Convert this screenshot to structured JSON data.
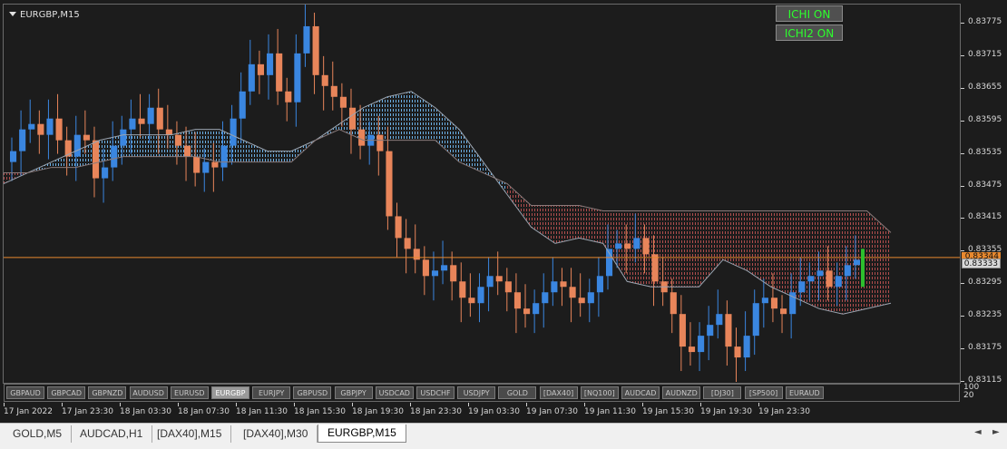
{
  "symbol_label": "EURGBP,M15",
  "buttons": {
    "ichi": "ICHI ON",
    "ichi2": "ICHI2 ON"
  },
  "colors": {
    "bull": "#3a86e0",
    "bear": "#e8855a",
    "cloud_bull": "#6fb7ef",
    "cloud_bear": "#a04848",
    "price_line": "#e8892f",
    "signal": "#2dbf2d",
    "background": "#1c1c1c"
  },
  "price_axis": {
    "ticks": [
      "0.83775",
      "0.83715",
      "0.83655",
      "0.83595",
      "0.83535",
      "0.83475",
      "0.83415",
      "0.83355",
      "0.83295",
      "0.83235",
      "0.83175",
      "0.83115"
    ],
    "bid_tag": "0.83344",
    "ask_tag": "0.83333"
  },
  "time_axis": {
    "ticks": [
      "17 Jan 2022",
      "17 Jan 23:30",
      "18 Jan 03:30",
      "18 Jan 07:30",
      "18 Jan 11:30",
      "18 Jan 15:30",
      "18 Jan 19:30",
      "18 Jan 23:30",
      "19 Jan 03:30",
      "19 Jan 07:30",
      "19 Jan 11:30",
      "19 Jan 15:30",
      "19 Jan 19:30",
      "19 Jan 23:30"
    ]
  },
  "indicator_scale": [
    "100",
    "20"
  ],
  "symbols": [
    "GBPAUD",
    "GBPCAD",
    "GBPNZD",
    "AUDUSD",
    "EURUSD",
    "EURGBP",
    "EURJPY",
    "GBPUSD",
    "GBPJPY",
    "USDCAD",
    "USDCHF",
    "USDJPY",
    "GOLD",
    "[DAX40]",
    "[NQ100]",
    "AUDCAD",
    "AUDNZD",
    "[DJ30]",
    "[SP500]",
    "EURAUD"
  ],
  "active_symbol": "EURGBP",
  "tabs": [
    "GOLD,M5",
    "AUDCAD,H1",
    "[DAX40],M15",
    "[DAX40],M30",
    "EURGBP,M15"
  ],
  "active_tab": "EURGBP,M15",
  "chart_data": {
    "type": "candlestick",
    "symbol": "EURGBP",
    "timeframe": "M15",
    "ylim": [
      0.8311,
      0.8381
    ],
    "series": [
      {
        "name": "close",
        "values": [
          0.8354,
          0.8358,
          0.8359,
          0.8357,
          0.836,
          0.8356,
          0.8353,
          0.8357,
          0.8356,
          0.8349,
          0.8351,
          0.8355,
          0.8358,
          0.836,
          0.8359,
          0.8362,
          0.8358,
          0.8357,
          0.8355,
          0.8353,
          0.835,
          0.8352,
          0.8351,
          0.8355,
          0.836,
          0.8365,
          0.837,
          0.8368,
          0.8372,
          0.8365,
          0.8363,
          0.8372,
          0.8377,
          0.8368,
          0.8366,
          0.8364,
          0.8362,
          0.8358,
          0.8355,
          0.8357,
          0.8354,
          0.8342,
          0.8338,
          0.8336,
          0.8334,
          0.8331,
          0.8332,
          0.8333,
          0.833,
          0.8327,
          0.8326,
          0.8329,
          0.8331,
          0.833,
          0.8328,
          0.8325,
          0.8324,
          0.8326,
          0.8328,
          0.833,
          0.8329,
          0.8327,
          0.8326,
          0.8328,
          0.8331,
          0.8336,
          0.8337,
          0.8336,
          0.8338,
          0.8335,
          0.833,
          0.8328,
          0.8324,
          0.8318,
          0.8317,
          0.832,
          0.8322,
          0.8324,
          0.8318,
          0.8316,
          0.832,
          0.8326,
          0.8327,
          0.8325,
          0.8324,
          0.8328,
          0.833,
          0.8331,
          0.8332,
          0.8329,
          0.8331,
          0.8333,
          0.8334
        ]
      }
    ],
    "cloud": {
      "span_a": [
        0.8348,
        0.835,
        0.8352,
        0.8354,
        0.8356,
        0.8357,
        0.8357,
        0.8357,
        0.8358,
        0.8358,
        0.8356,
        0.8354,
        0.8354,
        0.8356,
        0.8359,
        0.8362,
        0.8364,
        0.8365,
        0.8362,
        0.8358,
        0.8352,
        0.8346,
        0.834,
        0.8337,
        0.8338,
        0.8337,
        0.833,
        0.8329,
        0.8329,
        0.8329,
        0.8334,
        0.8332,
        0.8329,
        0.8327,
        0.8325,
        0.8324,
        0.8325,
        0.8326
      ],
      "span_b": [
        0.835,
        0.835,
        0.8351,
        0.8351,
        0.8352,
        0.8353,
        0.8353,
        0.8353,
        0.8353,
        0.8352,
        0.8352,
        0.8352,
        0.8352,
        0.8356,
        0.8358,
        0.8356,
        0.8356,
        0.8356,
        0.8356,
        0.8352,
        0.835,
        0.8348,
        0.8344,
        0.8344,
        0.8344,
        0.8343,
        0.8343,
        0.8343,
        0.8343,
        0.8343,
        0.8343,
        0.8343,
        0.8343,
        0.8343,
        0.8343,
        0.8343,
        0.8343,
        0.8339
      ]
    },
    "current_price": 0.83344
  }
}
